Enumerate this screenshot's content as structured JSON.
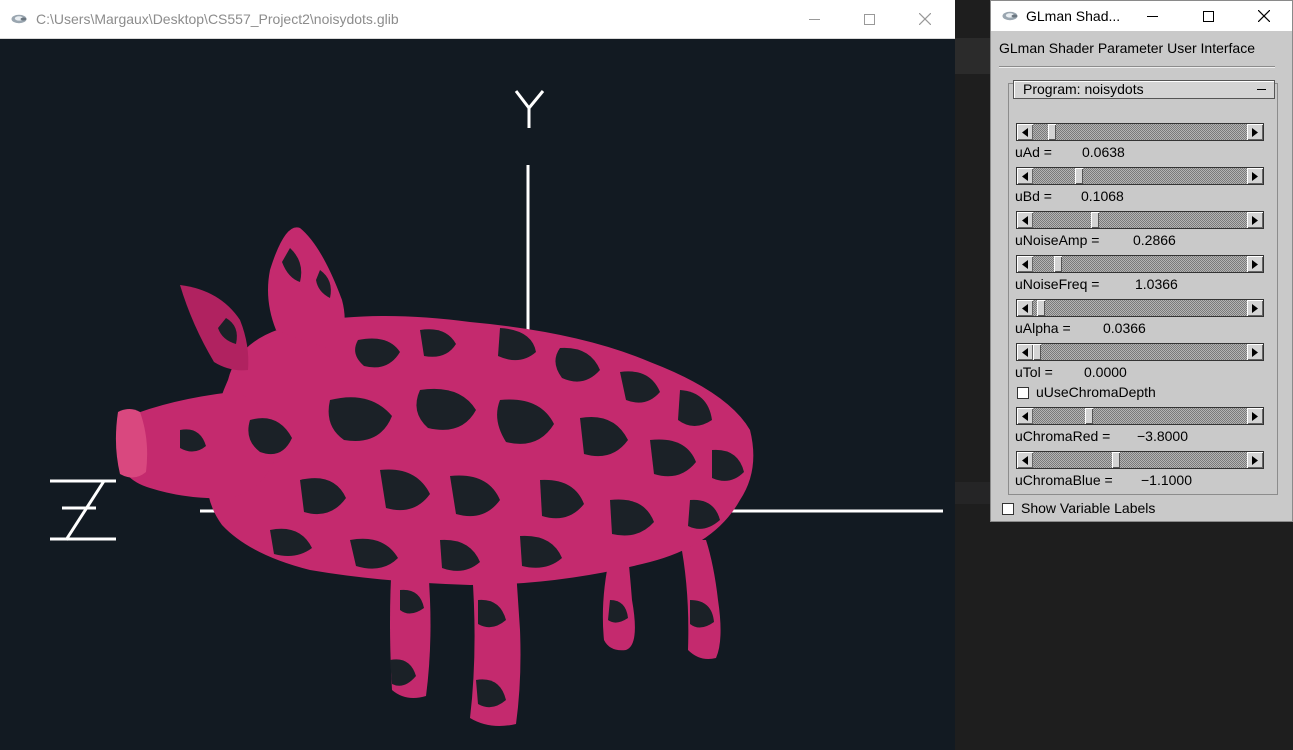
{
  "main_window": {
    "title": "C:\\Users\\Margaux\\Desktop\\CS557_Project2\\noisydots.glib",
    "axes": {
      "y_label": "Y",
      "z_label": "Z"
    }
  },
  "ui_window": {
    "title": "GLman Shad...",
    "heading": "GLman Shader Parameter User Interface",
    "program_label": "Program: noisydots",
    "sliders": [
      {
        "name": "uAd =",
        "value": "0.0638",
        "fraction": 0.07
      },
      {
        "name": "uBd =",
        "value": "0.1068",
        "fraction": 0.2
      },
      {
        "name": "uNoiseAmp =",
        "value": "0.2866",
        "fraction": 0.28
      },
      {
        "name": "uNoiseFreq =",
        "value": "1.0366",
        "fraction": 0.1
      },
      {
        "name": "uAlpha =",
        "value": "0.0366",
        "fraction": 0.02
      },
      {
        "name": "uTol =",
        "value": "0.0000",
        "fraction": 0.0
      }
    ],
    "chroma_checkbox": {
      "label": "uUseChromaDepth",
      "checked": false
    },
    "chroma_sliders": [
      {
        "name": "uChromaRed =",
        "value": "−3.8000",
        "fraction": 0.25
      },
      {
        "name": "uChromaBlue =",
        "value": "−1.1000",
        "fraction": 0.38
      }
    ],
    "labels_checkbox": {
      "label": "Show Variable Labels",
      "checked": false
    }
  },
  "colors": {
    "gl_background": "#121a22",
    "pig_pink": "#c42a6e",
    "pig_dark_spots": "#1b2127",
    "axes": "#ffffff"
  }
}
